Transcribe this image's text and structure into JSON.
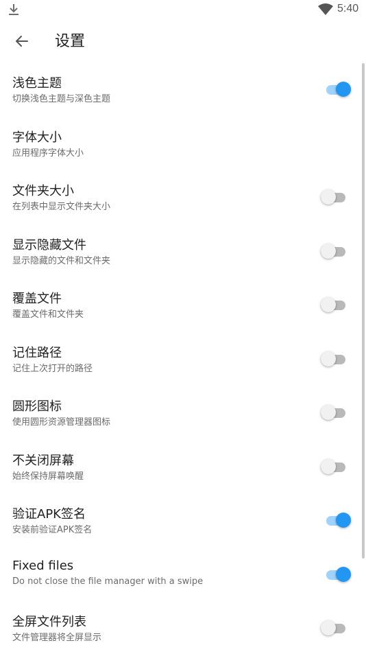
{
  "status_bar": {
    "time": "5:40",
    "icons": [
      "download-icon",
      "wifi-icon"
    ]
  },
  "app_bar": {
    "title": "设置",
    "back_icon": "arrow-back-icon"
  },
  "settings": [
    {
      "title": "浅色主题",
      "subtitle": "切换浅色主题与深色主题",
      "toggle": true
    },
    {
      "title": "字体大小",
      "subtitle": "应用程序字体大小",
      "toggle": null
    },
    {
      "title": "文件夹大小",
      "subtitle": "在列表中显示文件夹大小",
      "toggle": false
    },
    {
      "title": "显示隐藏文件",
      "subtitle": "显示隐藏的文件和文件夹",
      "toggle": false
    },
    {
      "title": "覆盖文件",
      "subtitle": "覆盖文件和文件夹",
      "toggle": false
    },
    {
      "title": "记住路径",
      "subtitle": "记住上次打开的路径",
      "toggle": false
    },
    {
      "title": "圆形图标",
      "subtitle": "使用圆形资源管理器图标",
      "toggle": false
    },
    {
      "title": "不关闭屏幕",
      "subtitle": "始终保持屏幕唤醒",
      "toggle": false
    },
    {
      "title": "验证APK签名",
      "subtitle": "安装前验证APK签名",
      "toggle": true
    },
    {
      "title": "Fixed files",
      "subtitle": "Do not close the file manager with a swipe",
      "toggle": true
    },
    {
      "title": "全屏文件列表",
      "subtitle": "文件管理器将全屏显示",
      "toggle": false
    }
  ],
  "colors": {
    "accent": "#2196f3",
    "accent_track": "#9fd3fb",
    "off_track": "#b9b9b9",
    "off_thumb": "#f1f1f1"
  }
}
